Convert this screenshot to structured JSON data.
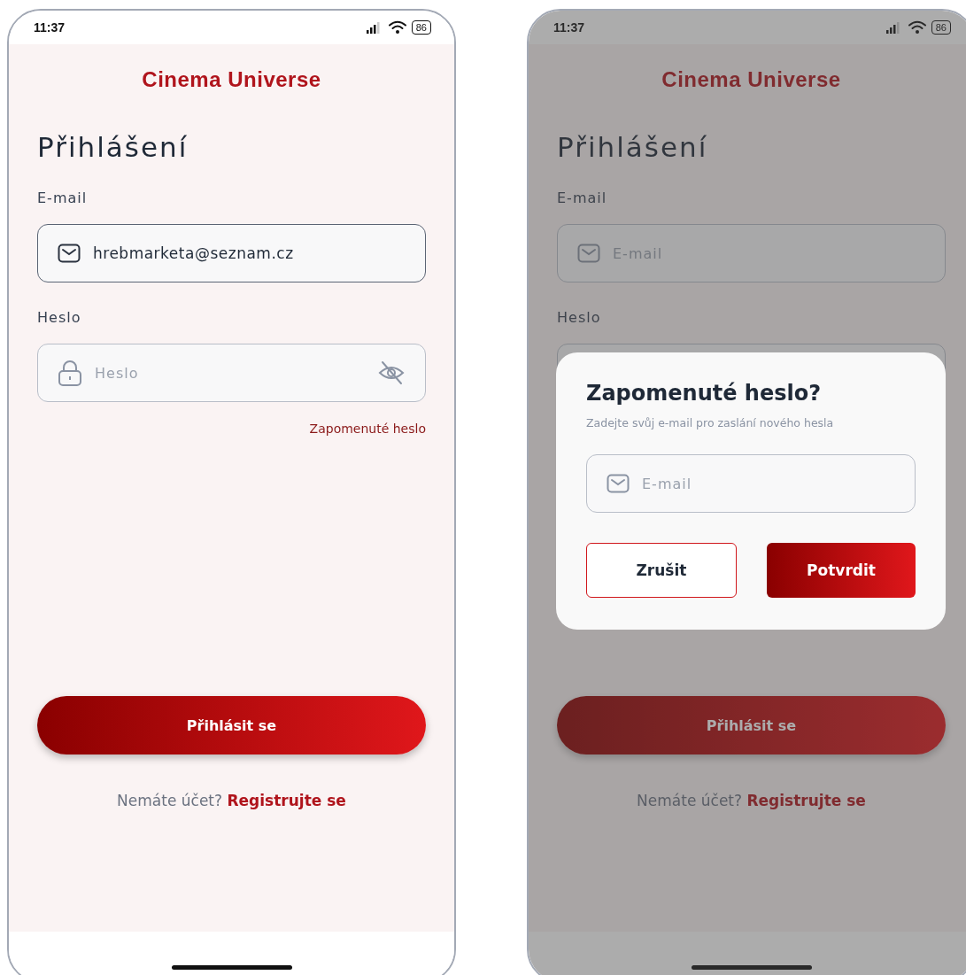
{
  "screens": [
    {
      "status": {
        "time": "11:37",
        "battery": "86"
      },
      "logo": "Cinema Universe",
      "title": "Přihlášení",
      "fields": [
        {
          "label": "E-mail",
          "kind": "email",
          "value": "hrebmarketa@seznam.cz"
        },
        {
          "label": "Heslo",
          "kind": "password",
          "placeholder": "Heslo",
          "visibility_toggle": true
        }
      ],
      "forgot_link": "Zapomenuté heslo",
      "submit": "Přihlásit se",
      "register": {
        "prompt": "Nemáte účet?",
        "link": "Registrujte se"
      },
      "dimmed": false
    },
    {
      "status": {
        "time": "11:37",
        "battery": "86"
      },
      "logo": "Cinema Universe",
      "title": "Přihlášení",
      "fields": [
        {
          "label": "E-mail",
          "kind": "email",
          "placeholder": "E-mail"
        },
        {
          "label": "Heslo"
        }
      ],
      "submit": "Přihlásit se",
      "register": {
        "prompt": "Nemáte účet?",
        "link": "Registrujte se"
      },
      "dimmed": true,
      "dialog": {
        "title": "Zapomenuté heslo?",
        "subtitle": "Zadejte svůj e-mail pro zaslání nového hesla",
        "field": {
          "kind": "email",
          "placeholder": "E-mail"
        },
        "buttons": [
          {
            "label": "Zrušit",
            "kind": "secondary"
          },
          {
            "label": "Potvrdit",
            "kind": "primary"
          }
        ]
      }
    }
  ]
}
